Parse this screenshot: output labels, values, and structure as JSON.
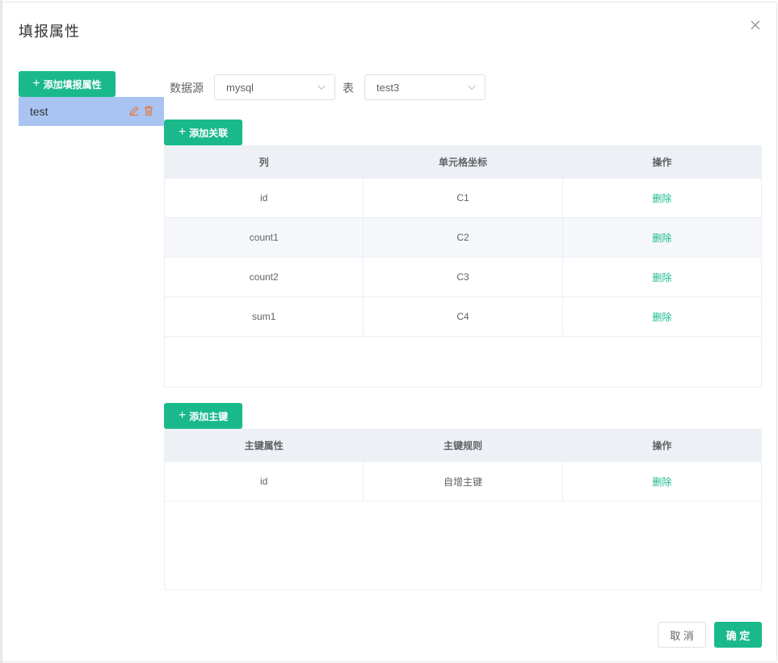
{
  "dialog": {
    "title": "填报属性"
  },
  "left": {
    "add_button": "添加填报属性",
    "items": [
      {
        "label": "test"
      }
    ]
  },
  "source": {
    "datasource_label": "数据源",
    "datasource_value": "mysql",
    "table_label": "表",
    "table_value": "test3"
  },
  "mapping": {
    "add_button": "添加关联",
    "headers": [
      "列",
      "单元格坐标",
      "操作"
    ],
    "rows": [
      {
        "column": "id",
        "cell": "C1",
        "action": "删除"
      },
      {
        "column": "count1",
        "cell": "C2",
        "action": "删除"
      },
      {
        "column": "count2",
        "cell": "C3",
        "action": "删除"
      },
      {
        "column": "sum1",
        "cell": "C4",
        "action": "删除"
      }
    ]
  },
  "keys": {
    "add_button": "添加主键",
    "headers": [
      "主键属性",
      "主键规则",
      "操作"
    ],
    "rows": [
      {
        "attr": "id",
        "rule": "自增主键",
        "action": "删除"
      }
    ]
  },
  "footer": {
    "cancel": "取 消",
    "confirm": "确 定"
  },
  "colors": {
    "accent": "#19b98c",
    "selected_item": "#a9c3f2",
    "header_bg": "#edf0f4"
  }
}
